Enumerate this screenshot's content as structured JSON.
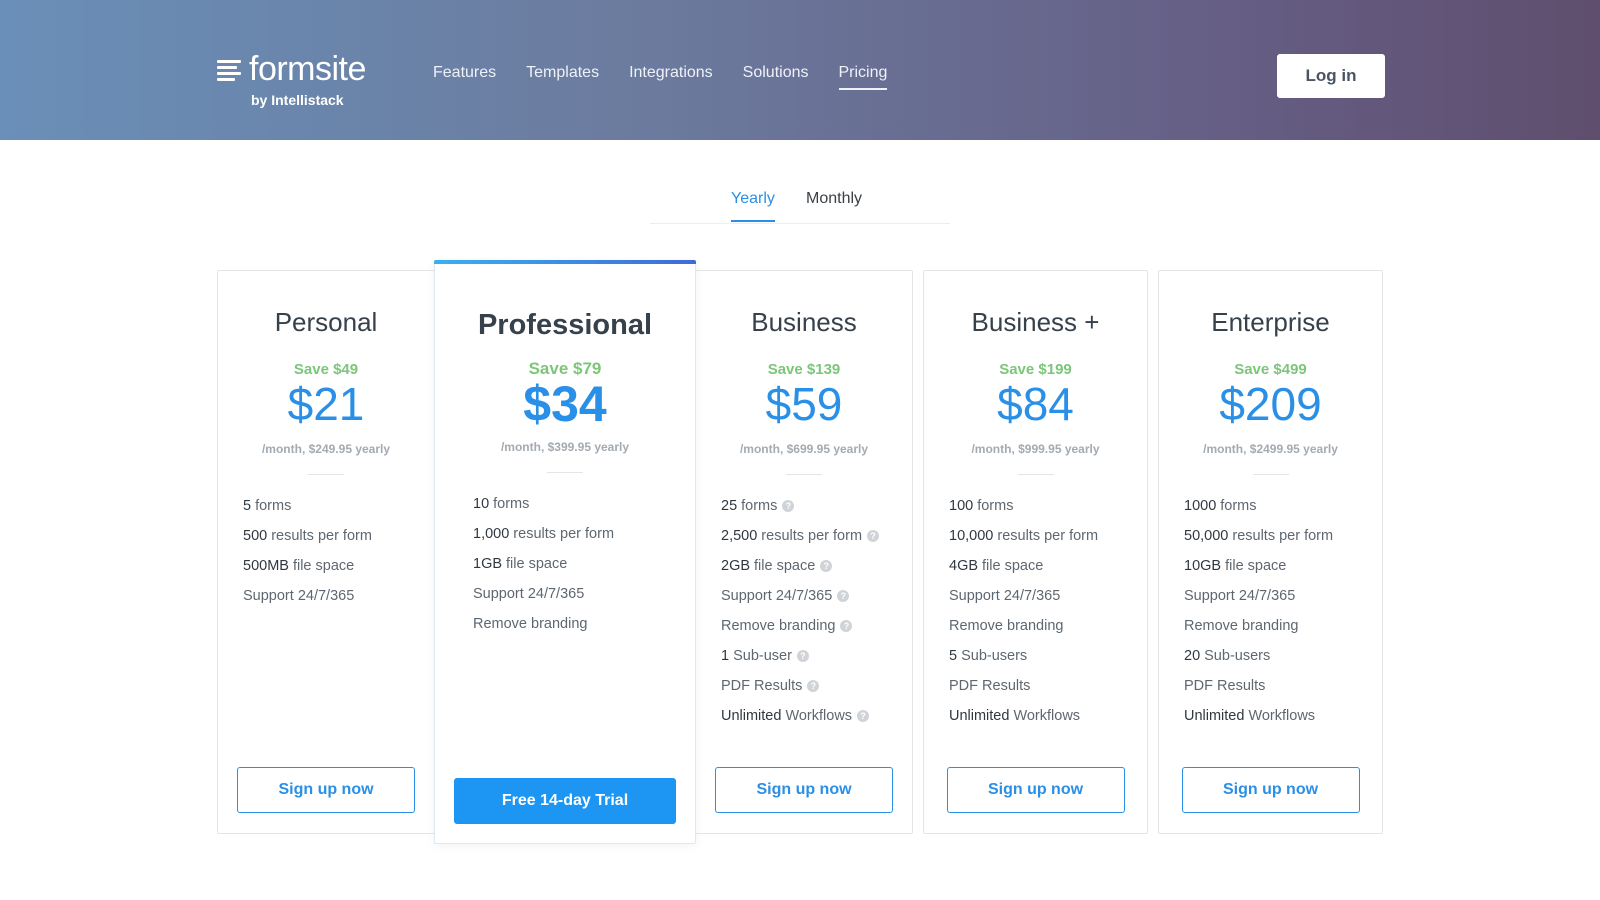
{
  "header": {
    "logo_word": "formsite",
    "logo_sub": "by Intellistack",
    "nav": [
      {
        "label": "Features"
      },
      {
        "label": "Templates"
      },
      {
        "label": "Integrations"
      },
      {
        "label": "Solutions"
      },
      {
        "label": "Pricing",
        "active": true
      }
    ],
    "login_label": "Log in"
  },
  "billing_tabs": {
    "yearly": "Yearly",
    "monthly": "Monthly",
    "selected": "Yearly"
  },
  "colors": {
    "accent": "#2a8fe6",
    "save_green": "#7cc67a",
    "primary_button": "#1d96f3"
  },
  "plans": [
    {
      "name": "Personal",
      "save": "Save $49",
      "price": "$21",
      "period": "/month, $249.95 yearly",
      "features": [
        {
          "amount": "5",
          "text": "forms",
          "help": false
        },
        {
          "amount": "500",
          "text": "results per form",
          "help": false
        },
        {
          "amount": "500MB",
          "text": "file space",
          "help": false
        },
        {
          "amount": "",
          "text": "Support 24/7/365",
          "help": false
        }
      ],
      "cta": "Sign up now"
    },
    {
      "name": "Professional",
      "save": "Save $79",
      "price": "$34",
      "period": "/month, $399.95 yearly",
      "features": [
        {
          "amount": "10",
          "text": "forms",
          "help": false
        },
        {
          "amount": "1,000",
          "text": "results per form",
          "help": false
        },
        {
          "amount": "1GB",
          "text": "file space",
          "help": false
        },
        {
          "amount": "",
          "text": "Support 24/7/365",
          "help": false
        },
        {
          "amount": "",
          "text": "Remove branding",
          "help": false
        }
      ],
      "cta": "Free 14-day Trial"
    },
    {
      "name": "Business",
      "save": "Save $139",
      "price": "$59",
      "period": "/month, $699.95 yearly",
      "features": [
        {
          "amount": "25",
          "text": "forms",
          "help": true
        },
        {
          "amount": "2,500",
          "text": "results per form",
          "help": true
        },
        {
          "amount": "2GB",
          "text": "file space",
          "help": true
        },
        {
          "amount": "",
          "text": "Support 24/7/365",
          "help": true
        },
        {
          "amount": "",
          "text": "Remove branding",
          "help": true
        },
        {
          "amount": "1",
          "text": "Sub-user",
          "help": true
        },
        {
          "amount": "",
          "text": "PDF Results",
          "help": true
        },
        {
          "amount": "Unlimited",
          "text": "Workflows",
          "help": true
        }
      ],
      "cta": "Sign up now"
    },
    {
      "name": "Business +",
      "save": "Save $199",
      "price": "$84",
      "period": "/month, $999.95 yearly",
      "features": [
        {
          "amount": "100",
          "text": "forms",
          "help": false
        },
        {
          "amount": "10,000",
          "text": "results per form",
          "help": false
        },
        {
          "amount": "4GB",
          "text": "file space",
          "help": false
        },
        {
          "amount": "",
          "text": "Support 24/7/365",
          "help": false
        },
        {
          "amount": "",
          "text": "Remove branding",
          "help": false
        },
        {
          "amount": "5",
          "text": "Sub-users",
          "help": false
        },
        {
          "amount": "",
          "text": "PDF Results",
          "help": false
        },
        {
          "amount": "Unlimited",
          "text": "Workflows",
          "help": false
        }
      ],
      "cta": "Sign up now"
    },
    {
      "name": "Enterprise",
      "save": "Save $499",
      "price": "$209",
      "period": "/month, $2499.95 yearly",
      "features": [
        {
          "amount": "1000",
          "text": "forms",
          "help": false
        },
        {
          "amount": "50,000",
          "text": "results per form",
          "help": false
        },
        {
          "amount": "10GB",
          "text": "file space",
          "help": false
        },
        {
          "amount": "",
          "text": "Support 24/7/365",
          "help": false
        },
        {
          "amount": "",
          "text": "Remove branding",
          "help": false
        },
        {
          "amount": "20",
          "text": "Sub-users",
          "help": false
        },
        {
          "amount": "",
          "text": "PDF Results",
          "help": false
        },
        {
          "amount": "Unlimited",
          "text": "Workflows",
          "help": false
        }
      ],
      "cta": "Sign up now"
    }
  ]
}
